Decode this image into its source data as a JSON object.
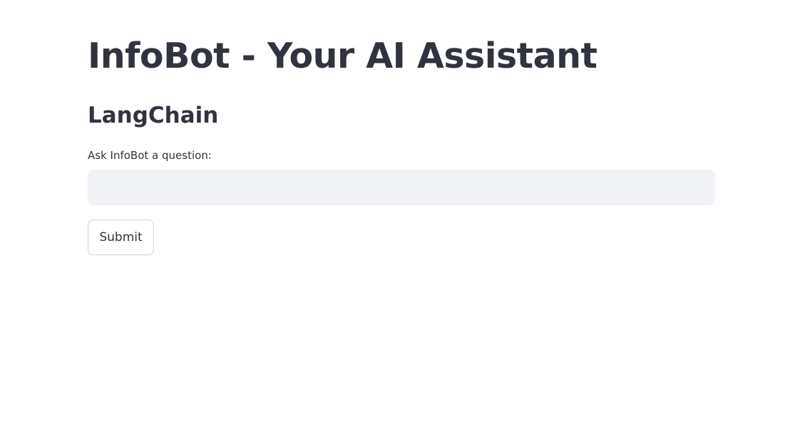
{
  "page": {
    "title": "InfoBot - Your AI Assistant",
    "subheader": "LangChain"
  },
  "form": {
    "question_label": "Ask InfoBot a question:",
    "question_value": "",
    "submit_label": "Submit"
  },
  "colors": {
    "text": "#31333f",
    "input_background": "#f0f2f6",
    "button_border": "#d3d4d8",
    "background": "#ffffff"
  }
}
